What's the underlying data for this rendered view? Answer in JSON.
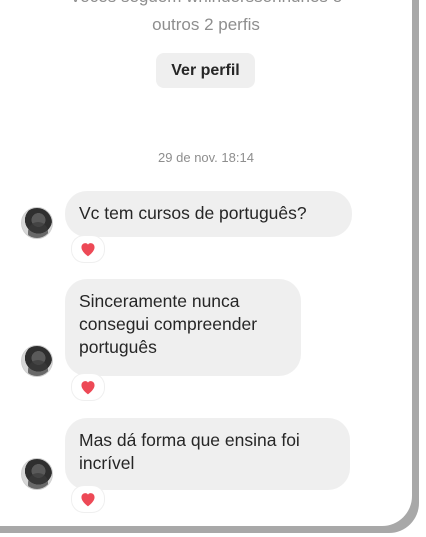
{
  "header": {
    "line1": "Vocês seguem whindersson­nunes e",
    "line2": "outros 2 perfis",
    "view_profile_label": "Ver perfil"
  },
  "timestamp": "29 de nov. 18:14",
  "messages": [
    {
      "text": "Vc tem cursos de português?",
      "reaction": "heart-icon"
    },
    {
      "text": "Sinceramente nunca consegui compreender português",
      "reaction": "heart-icon"
    },
    {
      "text": "Mas dá forma que ensina foi incrível",
      "reaction": "heart-icon"
    }
  ],
  "colors": {
    "bubble": "#efefef",
    "heart": "#ed4956",
    "muted_text": "#8e8e8e",
    "text": "#262626"
  }
}
